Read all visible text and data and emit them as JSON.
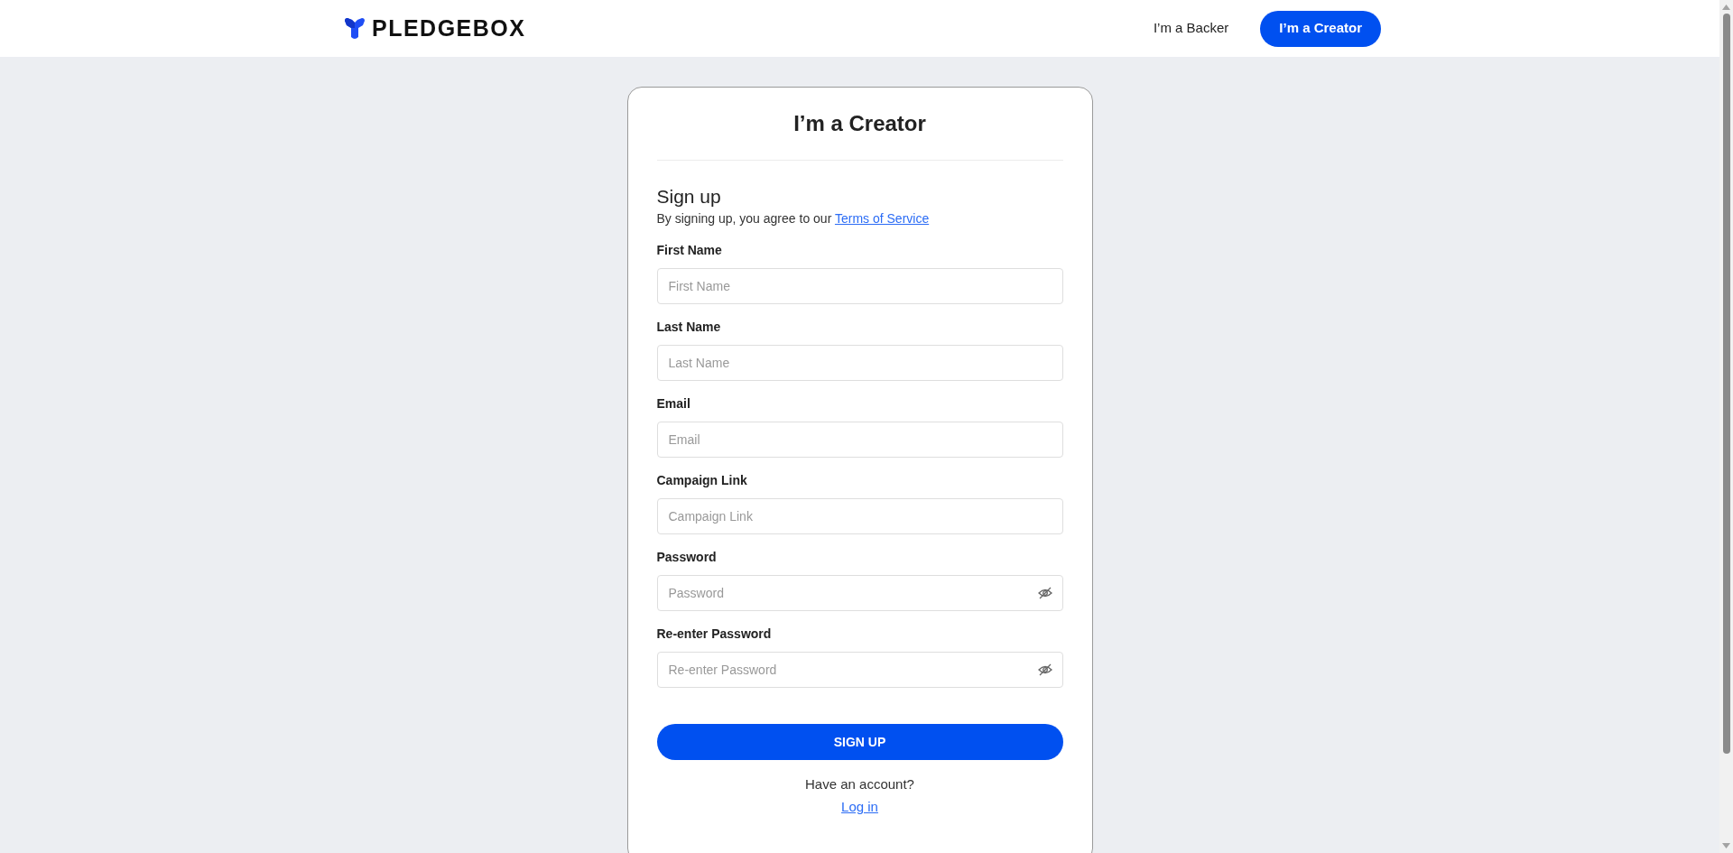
{
  "header": {
    "brand": "PLEDGEBOX",
    "nav": [
      {
        "label": "I’m a Backer",
        "selected": false
      },
      {
        "label": "I’m a Creator",
        "selected": true
      }
    ]
  },
  "card": {
    "title": "I’m a Creator",
    "heading": "Sign up",
    "agreement": "By signing up, you agree to our",
    "terms_link": "Terms of Service",
    "fields": [
      {
        "label": "First Name",
        "placeholder": "First Name",
        "kind": "text"
      },
      {
        "label": "Last Name",
        "placeholder": "Last Name",
        "kind": "text"
      },
      {
        "label": "Email",
        "placeholder": "Email",
        "kind": "text"
      },
      {
        "label": "Campaign Link",
        "placeholder": "Campaign Link",
        "kind": "text"
      },
      {
        "label": "Password",
        "placeholder": "Password",
        "kind": "password"
      },
      {
        "label": "Re-enter Password",
        "placeholder": "Re-enter Password",
        "kind": "password"
      }
    ],
    "submit": "SIGN UP",
    "account_prompt": "Have an account?",
    "login_link": "Log in"
  }
}
